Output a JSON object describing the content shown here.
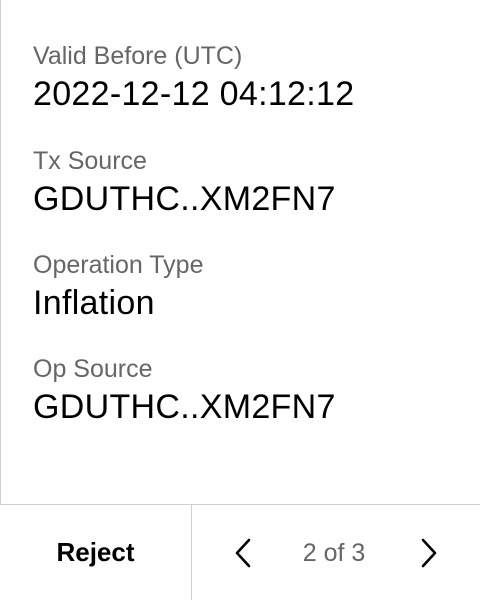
{
  "fields": [
    {
      "label": "Valid Before (UTC)",
      "value": "2022-12-12 04:12:12"
    },
    {
      "label": "Tx Source",
      "value": "GDUTHC..XM2FN7"
    },
    {
      "label": "Operation Type",
      "value": "Inflation"
    },
    {
      "label": "Op Source",
      "value": "GDUTHC..XM2FN7"
    }
  ],
  "footer": {
    "reject_label": "Reject",
    "pager": {
      "current": 2,
      "total": 3,
      "text": "2 of 3",
      "prev_icon": "chevron-left-icon",
      "next_icon": "chevron-right-icon"
    }
  },
  "colors": {
    "label": "#666666",
    "value": "#000000",
    "divider": "#cfcfcf",
    "background": "#ffffff"
  }
}
